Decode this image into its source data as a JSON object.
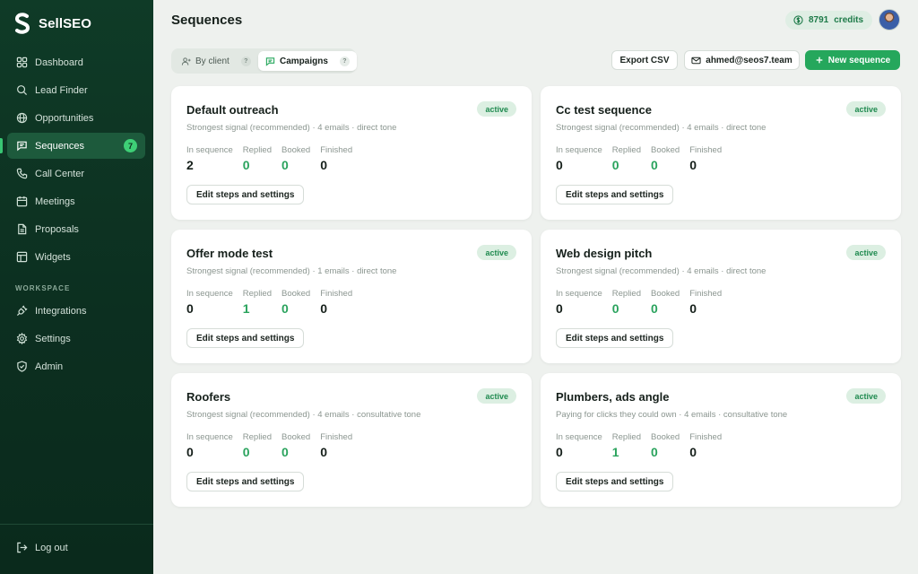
{
  "app": {
    "name": "SellSEO"
  },
  "sidebar": {
    "items": [
      {
        "label": "Dashboard",
        "icon": "dashboard-icon"
      },
      {
        "label": "Lead Finder",
        "icon": "search-icon"
      },
      {
        "label": "Opportunities",
        "icon": "globe-icon"
      },
      {
        "label": "Sequences",
        "icon": "message-square-icon",
        "badge": "7",
        "active": true
      },
      {
        "label": "Call Center",
        "icon": "phone-icon"
      },
      {
        "label": "Meetings",
        "icon": "calendar-icon"
      },
      {
        "label": "Proposals",
        "icon": "file-text-icon"
      },
      {
        "label": "Widgets",
        "icon": "layout-icon"
      }
    ],
    "workspace_label": "WORKSPACE",
    "workspace_items": [
      {
        "label": "Integrations",
        "icon": "plug-icon"
      },
      {
        "label": "Settings",
        "icon": "gear-icon"
      },
      {
        "label": "Admin",
        "icon": "shield-icon"
      }
    ],
    "logout_label": "Log out"
  },
  "header": {
    "title": "Sequences",
    "credits": "8791",
    "credits_label": "credits"
  },
  "toolbar": {
    "tabs": [
      {
        "label": "By client",
        "help": "?"
      },
      {
        "label": "Campaigns",
        "help": "?",
        "active": true
      }
    ],
    "export_label": "Export CSV",
    "email": "ahmed@seos7.team",
    "new_label": "New sequence"
  },
  "stat_labels": {
    "in_sequence": "In sequence",
    "replied": "Replied",
    "booked": "Booked",
    "finished": "Finished"
  },
  "cards": [
    {
      "title": "Default outreach",
      "status": "active",
      "subtitle": "Strongest signal (recommended) · 4 emails · direct tone",
      "in_sequence": "2",
      "replied": "0",
      "booked": "0",
      "finished": "0",
      "button": "Edit steps and settings"
    },
    {
      "title": "Cc test sequence",
      "status": "active",
      "subtitle": "Strongest signal (recommended) · 4 emails · direct tone",
      "in_sequence": "0",
      "replied": "0",
      "booked": "0",
      "finished": "0",
      "button": "Edit steps and settings"
    },
    {
      "title": "Offer mode test",
      "status": "active",
      "subtitle": "Strongest signal (recommended) · 1 emails · direct tone",
      "in_sequence": "0",
      "replied": "1",
      "booked": "0",
      "finished": "0",
      "button": "Edit steps and settings"
    },
    {
      "title": "Web design pitch",
      "status": "active",
      "subtitle": "Strongest signal (recommended) · 4 emails · direct tone",
      "in_sequence": "0",
      "replied": "0",
      "booked": "0",
      "finished": "0",
      "button": "Edit steps and settings"
    },
    {
      "title": "Roofers",
      "status": "active",
      "subtitle": "Strongest signal (recommended) · 4 emails · consultative tone",
      "in_sequence": "0",
      "replied": "0",
      "booked": "0",
      "finished": "0",
      "button": "Edit steps and settings"
    },
    {
      "title": "Plumbers, ads angle",
      "status": "active",
      "subtitle": "Paying for clicks they could own · 4 emails · consultative tone",
      "in_sequence": "0",
      "replied": "1",
      "booked": "0",
      "finished": "0",
      "button": "Edit steps and settings"
    }
  ],
  "colors": {
    "accent": "#25a75c",
    "sidebar": "#0f3b27",
    "status_bg": "#dcefe2",
    "status_text": "#1f8a4f"
  }
}
